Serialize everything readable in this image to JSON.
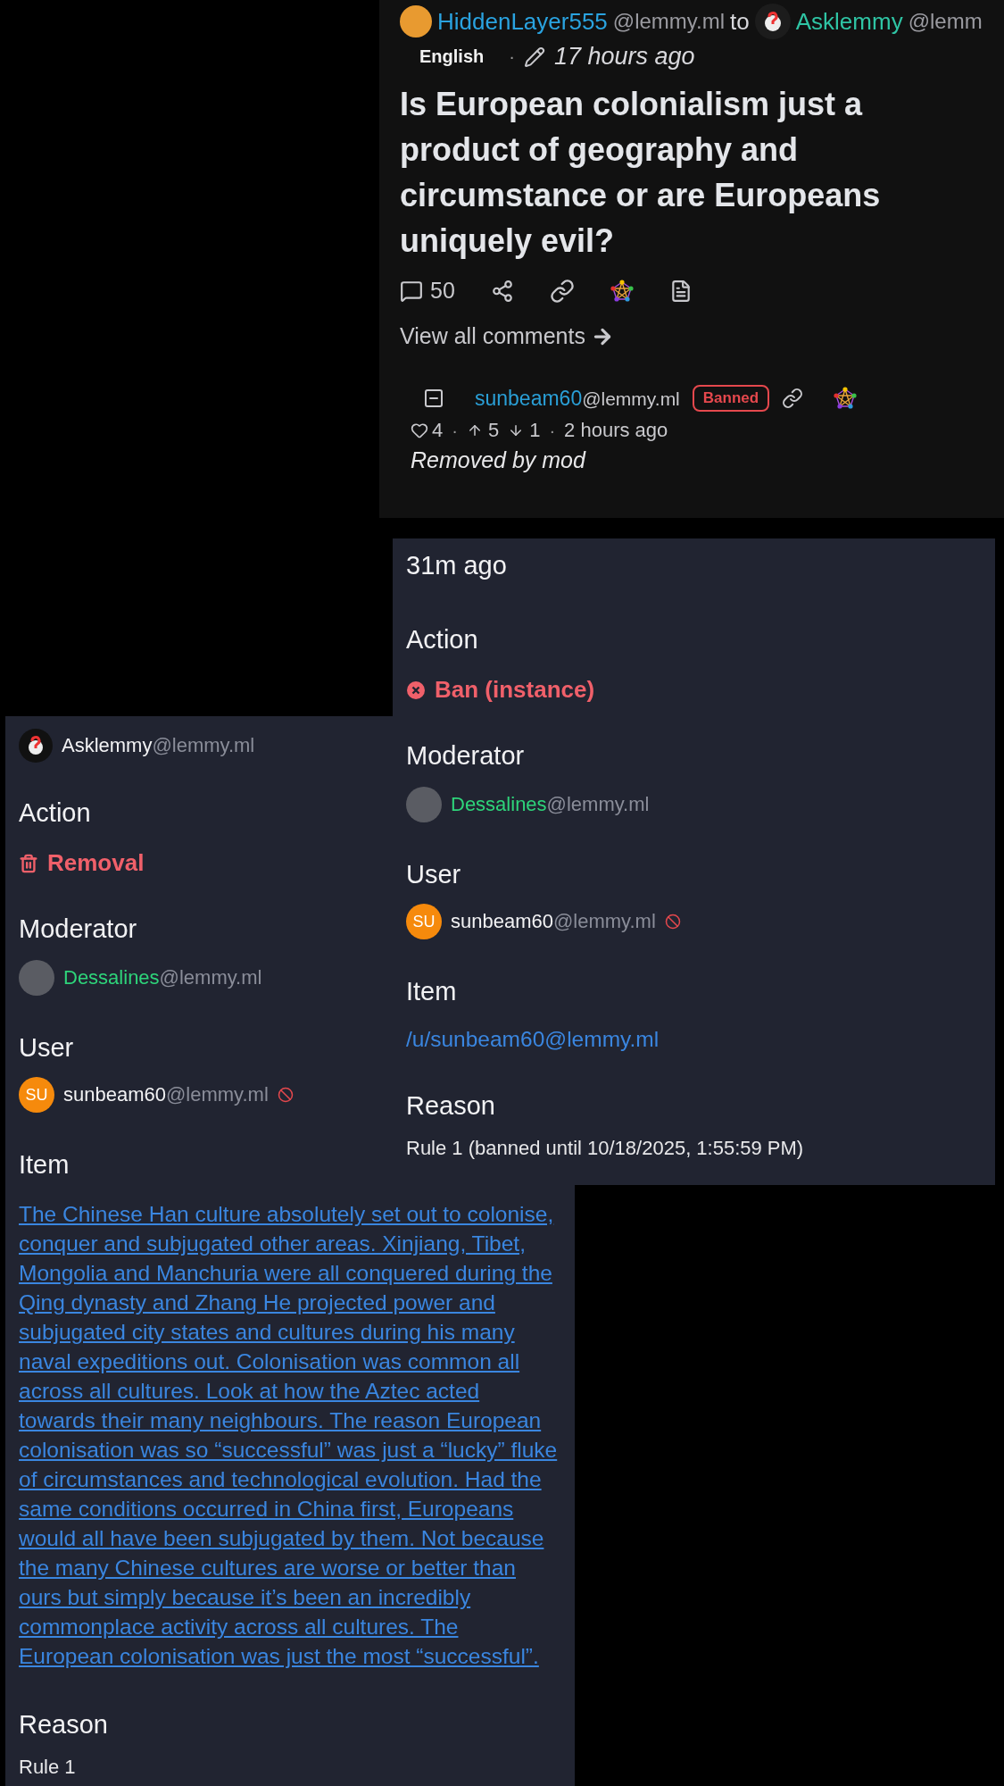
{
  "post": {
    "author": {
      "name": "HiddenLayer555",
      "instance": "@lemmy.ml"
    },
    "to_word": "to",
    "community": {
      "name": "Asklemmy",
      "instance": "@lemm"
    },
    "language": "English",
    "separator": "·",
    "time": "17 hours ago",
    "title": "Is European colonialism just a product of geography and circumstance or are Europeans uniquely evil?",
    "comment_count": "50",
    "view_all": "View all comments",
    "comment": {
      "author": "sunbeam60",
      "instance": "@lemmy.ml",
      "badge": "Banned",
      "likes": "4",
      "dot": "·",
      "upvotes": "5",
      "downvotes": "1",
      "dot2": "·",
      "time": "2 hours ago",
      "body": "Removed by mod"
    }
  },
  "modlog_entries": [
    {
      "header": {
        "kind": "time",
        "text": "31m ago"
      },
      "action": {
        "label": "Action",
        "kind": "ban",
        "text": "Ban (instance)"
      },
      "moderator": {
        "label": "Moderator",
        "name": "Dessalines",
        "instance": "@lemmy.ml"
      },
      "user": {
        "label": "User",
        "initials": "SU",
        "name": "sunbeam60",
        "instance": "@lemmy.ml",
        "banned": true
      },
      "item": {
        "label": "Item",
        "text": "/u/sunbeam60@lemmy.ml"
      },
      "reason": {
        "label": "Reason",
        "text": "Rule 1 (banned until 10/18/2025, 1:55:59 PM)"
      }
    },
    {
      "header": {
        "kind": "community",
        "name": "Asklemmy",
        "instance": "@lemmy.ml"
      },
      "action": {
        "label": "Action",
        "kind": "removal",
        "text": "Removal"
      },
      "moderator": {
        "label": "Moderator",
        "name": "Dessalines",
        "instance": "@lemmy.ml"
      },
      "user": {
        "label": "User",
        "initials": "SU",
        "name": "sunbeam60",
        "instance": "@lemmy.ml",
        "banned": true
      },
      "item": {
        "label": "Item",
        "text": "The Chinese Han culture absolutely set out to colonise, conquer and subjugated other areas. Xinjiang, Tibet, Mongolia and Manchuria were all conquered during the Qing dynasty and Zhang He projected power and subjugated city states and cultures during his many naval expeditions out. Colonisation was common all across all cultures. Look at how the Aztec acted towards their many neighbours. The reason European colonisation was so “successful” was just a “lucky” fluke of circumstances and technological evolution. Had the same conditions occurred in China first, Europeans would all have been subjugated by them. Not because the many Chinese cultures are worse or better than ours but simply because it’s been an incredibly commonplace activity across all cultures. The European colonisation was just the most “successful”."
      },
      "reason": {
        "label": "Reason",
        "text": "Rule 1"
      }
    }
  ]
}
